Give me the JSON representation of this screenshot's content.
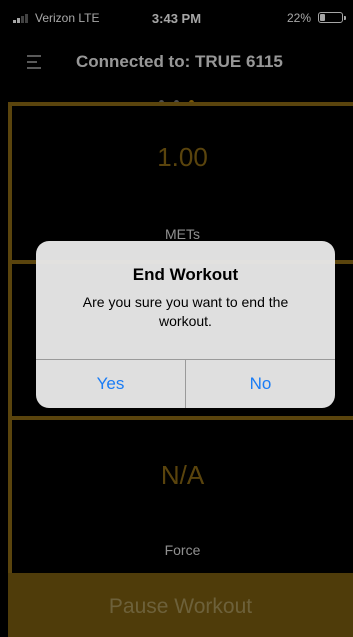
{
  "status_bar": {
    "carrier": "Verizon  LTE",
    "time": "3:43 PM",
    "battery_percent": "22%",
    "battery_level": 0.22
  },
  "header": {
    "menu_icon": "hamburger-menu-icon",
    "title": "Connected to: TRUE 6115"
  },
  "pager": {
    "count": 3,
    "active_index": 2
  },
  "metrics": [
    {
      "value": "1.00",
      "label": "METs"
    },
    {
      "value": "",
      "label": ""
    },
    {
      "value": "N/A",
      "label": "Force"
    }
  ],
  "pause_button": {
    "label": "Pause Workout"
  },
  "alert": {
    "title": "End Workout",
    "message": "Are you sure you want to end the workout.",
    "yes_label": "Yes",
    "no_label": "No"
  },
  "colors": {
    "accent": "#8b6914",
    "button": "#7a5c10",
    "link": "#1a7cf5"
  }
}
